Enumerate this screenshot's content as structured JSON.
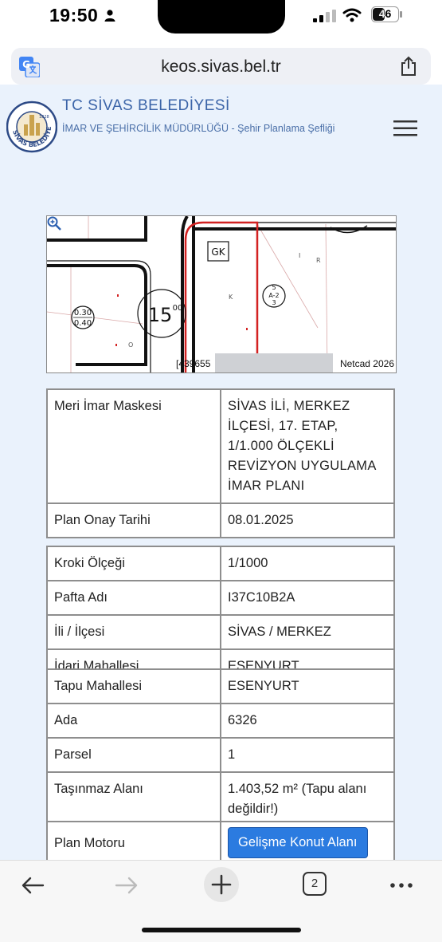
{
  "status_bar": {
    "time": "19:50",
    "battery": "46"
  },
  "browser": {
    "url": "keos.sivas.bel.tr",
    "tab_count": "2"
  },
  "site": {
    "title": "TC SİVAS BELEDİYESİ",
    "subtitle": "İMAR VE ŞEHİRCİLİK MÜDÜRLÜĞÜ - Şehir Planlama Şefliği",
    "logo_text": "SİVAS BELEDİYESİ",
    "logo_year": "1828"
  },
  "map": {
    "coord_text": "[439655",
    "credit": "Netcad 2026",
    "labels": {
      "gk": "GK",
      "ratio_top": "0.30",
      "ratio_bottom": "0.40",
      "parcel_no": "15",
      "parcel_sup": "00",
      "zone_top": "5",
      "zone_mid": "A-2",
      "zone_bottom": "3",
      "letter_k": "K",
      "letter_r": "R",
      "letter_i": "I",
      "letter_o": "O"
    }
  },
  "plan_table": {
    "rows": [
      {
        "key": "Meri İmar Maskesi",
        "value": "SİVAS İLİ, MERKEZ İLÇESİ, 17. ETAP, 1/1.000 ÖLÇEKLİ REVİZYON UYGULAMA İMAR PLANI"
      },
      {
        "key": "Plan Onay Tarihi",
        "value": "08.01.2025"
      }
    ]
  },
  "kroki_table": {
    "rows": [
      {
        "key": "Kroki Ölçeği",
        "value": "1/1000"
      },
      {
        "key": "Pafta Adı",
        "value": "I37C10B2A"
      },
      {
        "key": "İli / İlçesi",
        "value": "SİVAS / MERKEZ"
      },
      {
        "key": "İdari Mahallesi",
        "value": "ESENYURT"
      }
    ]
  },
  "tapu_table": {
    "rows": [
      {
        "key": "Tapu Mahallesi",
        "value": "ESENYURT"
      },
      {
        "key": "Ada",
        "value": "6326"
      },
      {
        "key": "Parsel",
        "value": "1"
      },
      {
        "key": "Taşınmaz Alanı",
        "value": "1.403,52 m² (Tapu alanı değildir!)"
      }
    ]
  },
  "motor_table": {
    "key": "Plan Motoru",
    "button_label": "Gelişme Konut Alanı"
  },
  "icons": {
    "translate": "translate-icon",
    "share": "share-icon",
    "menu": "hamburger-menu-icon",
    "zoom": "zoom-icon",
    "back": "back-arrow-icon",
    "forward": "forward-arrow-icon",
    "new_tab": "plus-icon",
    "tabs": "tabs-icon",
    "more": "more-dots-icon"
  },
  "colors": {
    "page_bg": "#eaf2fc",
    "brand_blue": "#3b64a8",
    "button_blue": "#2b7be0",
    "parcel_red": "#d32222"
  }
}
